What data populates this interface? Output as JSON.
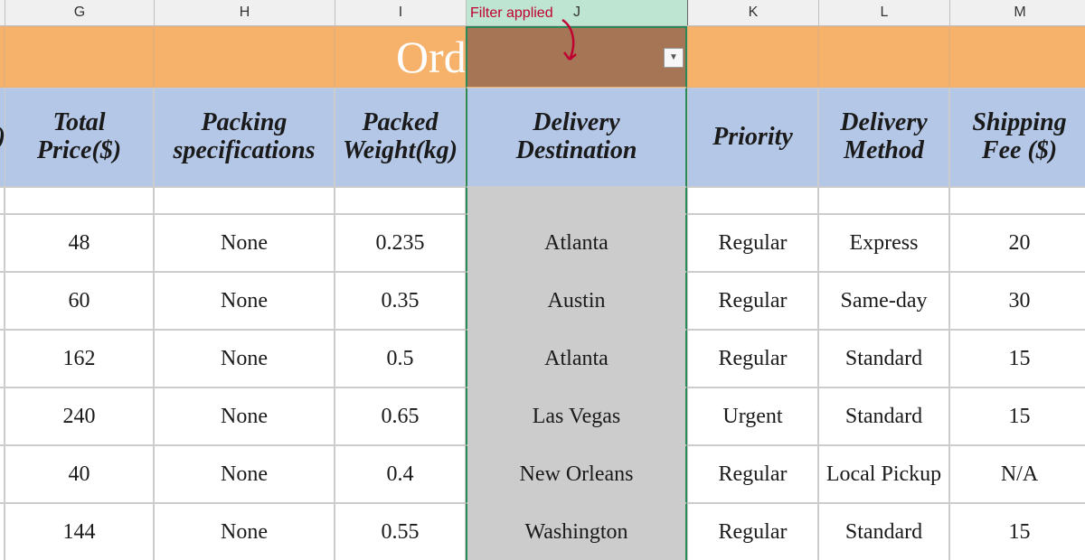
{
  "columns": [
    "G",
    "H",
    "I",
    "J",
    "K",
    "L",
    "M"
  ],
  "title": "Orders",
  "annotation": "Filter applied",
  "partial_header_left": ")",
  "headers": {
    "G": "Total Price($)",
    "H": "Packing specifications",
    "I": "Packed Weight(kg)",
    "J": "Delivery Destination",
    "K": "Priority",
    "L": "Delivery Method",
    "M": "Shipping Fee ($)"
  },
  "rows": [
    {
      "G": "48",
      "H": "None",
      "I": "0.235",
      "J": "Atlanta",
      "K": "Regular",
      "L": "Express",
      "M": "20"
    },
    {
      "G": "60",
      "H": "None",
      "I": "0.35",
      "J": "Austin",
      "K": "Regular",
      "L": "Same-day",
      "M": "30"
    },
    {
      "G": "162",
      "H": "None",
      "I": "0.5",
      "J": "Atlanta",
      "K": "Regular",
      "L": "Standard",
      "M": "15"
    },
    {
      "G": "240",
      "H": "None",
      "I": "0.65",
      "J": "Las Vegas",
      "K": "Urgent",
      "L": "Standard",
      "M": "15"
    },
    {
      "G": "40",
      "H": "None",
      "I": "0.4",
      "J": "New Orleans",
      "K": "Regular",
      "L": "Local Pickup",
      "M": "N/A"
    },
    {
      "G": "144",
      "H": "None",
      "I": "0.55",
      "J": "Washington",
      "K": "Regular",
      "L": "Standard",
      "M": "15"
    }
  ],
  "chart_data": {
    "type": "table",
    "title": "Orders",
    "columns": [
      "Total Price($)",
      "Packing specifications",
      "Packed Weight(kg)",
      "Delivery Destination",
      "Priority",
      "Delivery Method",
      "Shipping Fee ($)"
    ],
    "data": [
      [
        48,
        "None",
        0.235,
        "Atlanta",
        "Regular",
        "Express",
        20
      ],
      [
        60,
        "None",
        0.35,
        "Austin",
        "Regular",
        "Same-day",
        30
      ],
      [
        162,
        "None",
        0.5,
        "Atlanta",
        "Regular",
        "Standard",
        15
      ],
      [
        240,
        "None",
        0.65,
        "Las Vegas",
        "Urgent",
        "Standard",
        15
      ],
      [
        40,
        "None",
        0.4,
        "New Orleans",
        "Regular",
        "Local Pickup",
        "N/A"
      ],
      [
        144,
        "None",
        0.55,
        "Washington",
        "Regular",
        "Standard",
        15
      ]
    ]
  }
}
